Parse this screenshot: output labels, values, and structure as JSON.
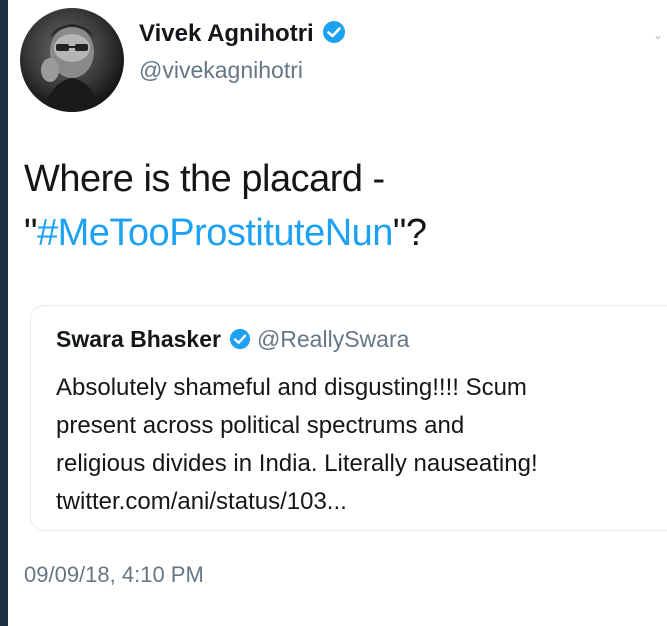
{
  "author": {
    "display_name": "Vivek Agnihotri",
    "handle": "@vivekagnihotri",
    "verified": true
  },
  "tweet": {
    "text_line_1": "Where is the placard -",
    "quote_open": "\"",
    "hashtag": "#MeTooProstituteNun",
    "quote_close": "\"?",
    "timestamp": "09/09/18, 4:10 PM"
  },
  "quoted_tweet": {
    "display_name": "Swara Bhasker",
    "handle": "@ReallySwara",
    "verified": true,
    "lines": [
      "Absolutely shameful and disgusting!!!! Scum",
      "present across political spectrums and",
      "religious divides in India. Literally nauseating!",
      "twitter.com/ani/status/103..."
    ]
  },
  "colors": {
    "link": "#1da1f2",
    "verified": "#1da1f2",
    "secondary_text": "#657786",
    "border": "#e6ecf0",
    "page_background": "#1f3144"
  },
  "icons": {
    "verified": "verified-badge-icon",
    "caret": "chevron-down-icon"
  }
}
